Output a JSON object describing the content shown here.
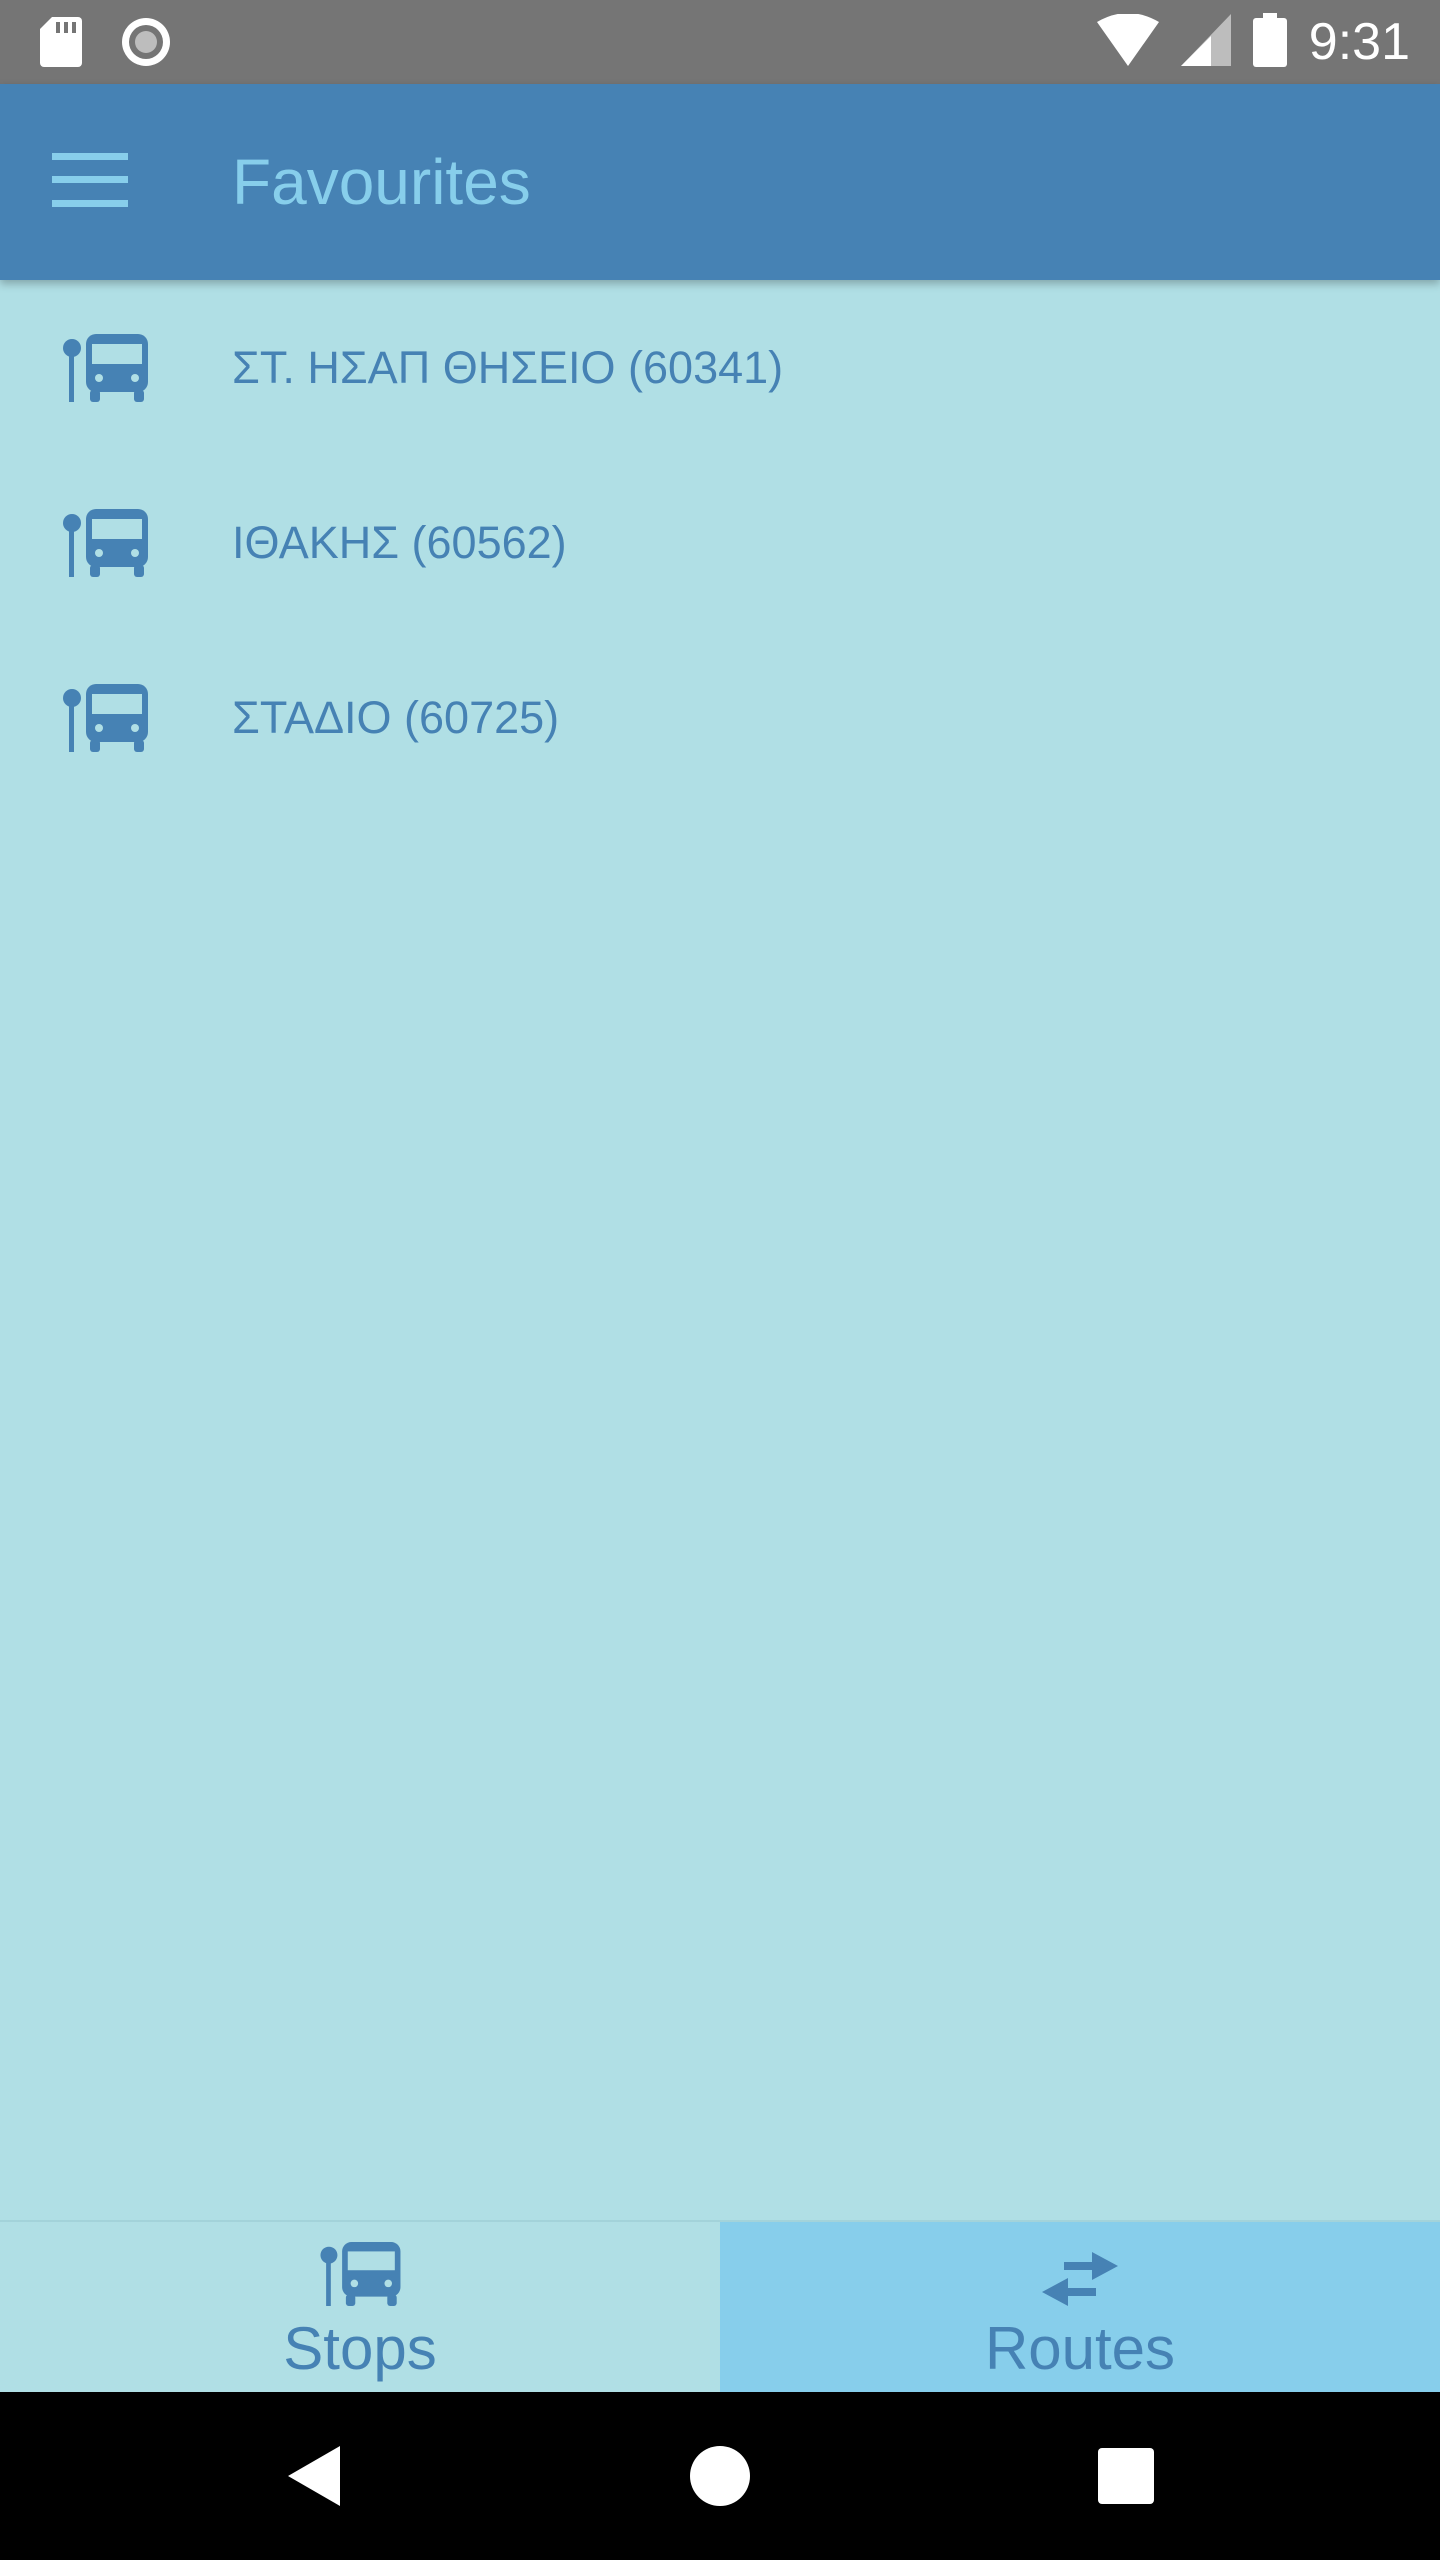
{
  "status_bar": {
    "time": "9:31",
    "icons": [
      "sd-card-icon",
      "record-icon",
      "wifi-icon",
      "signal-icon",
      "battery-icon"
    ]
  },
  "app_bar": {
    "title": "Favourites",
    "menu_icon": "menu-icon"
  },
  "favourites": [
    {
      "label": "ΣΤ. ΗΣΑΠ ΘΗΣΕΙΟ (60341)",
      "icon": "bus-stop-icon"
    },
    {
      "label": "ΙΘΑΚΗΣ (60562)",
      "icon": "bus-stop-icon"
    },
    {
      "label": "ΣΤΑΔΙΟ (60725)",
      "icon": "bus-stop-icon"
    }
  ],
  "bottom_nav": {
    "tabs": [
      {
        "label": "Stops",
        "icon": "bus-stop-icon",
        "active": false
      },
      {
        "label": "Routes",
        "icon": "swap-arrows-icon",
        "active": true
      }
    ]
  },
  "system_nav": {
    "buttons": [
      "back-icon",
      "home-icon",
      "recents-icon"
    ]
  },
  "colors": {
    "primary": "#4682b4",
    "accent": "#87ceeb",
    "background": "#b0dfe5",
    "status_bar": "#757575"
  }
}
